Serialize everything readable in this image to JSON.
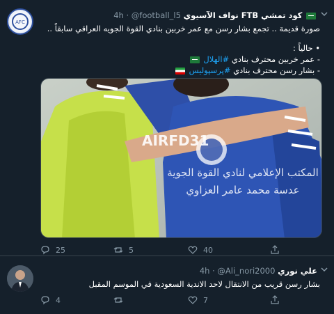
{
  "tweets": [
    {
      "display_name": "كود تمشي FTB نواف الآسيوي",
      "handle": "@football_l5",
      "separator": "·",
      "time": "4h",
      "lines": [
        "صورة قديمة .. تجمع بشار رسن مع عمر خربين بنادي القوة الجويه العراقي سابقاً ..",
        "• حالياً :",
        "- عمر خربين محترف بنادي #الهلال",
        "- بشار رسن محترف بنادي #پرسپولیس"
      ],
      "hashtags": [
        "#الهلال",
        "#پرسپولیس"
      ],
      "image": {
        "watermark": "AIRFD31",
        "caption_line1": "المكتب الإعلامي لنادي القوة الجوية",
        "caption_line2": "عدسة محمد عامر العزاوي"
      },
      "stats": {
        "replies": "25",
        "retweets": "5",
        "likes": "40"
      }
    },
    {
      "display_name": "علي نوري",
      "handle": "@Ali_nori2000",
      "separator": "·",
      "time": "4h",
      "lines": [
        "بشار رسن قريب من الانتقال لاحد الاندية السعودية في الموسم المقبل"
      ],
      "stats": {
        "replies": "4",
        "retweets": "",
        "likes": "7"
      }
    }
  ],
  "icons": [
    "chevron-down-icon",
    "reply-icon",
    "retweet-icon",
    "like-icon",
    "share-icon"
  ],
  "colors": {
    "background": "#15202b",
    "secondary_text": "#8899a6",
    "link": "#1da1f2",
    "divider": "#38444d"
  }
}
